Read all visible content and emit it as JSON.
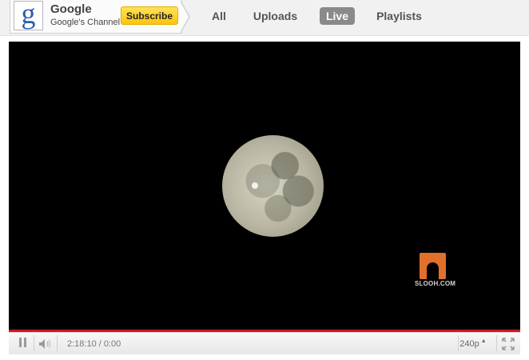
{
  "channel": {
    "name": "Google",
    "subtitle": "Google's Channel",
    "avatar_letter": "g",
    "subscribe_label": "Subscribe",
    "accent": "#ffc40d"
  },
  "tabs": [
    {
      "label": "All",
      "active": false
    },
    {
      "label": "Uploads",
      "active": false
    },
    {
      "label": "Live",
      "active": true
    },
    {
      "label": "Playlists",
      "active": false
    }
  ],
  "video": {
    "watermark": "SLOOH.COM",
    "progress_color": "#cc181e"
  },
  "controls": {
    "time": "2:18:10 / 0:00",
    "quality": "240p",
    "icons": [
      "pause-icon",
      "volume-icon",
      "fullscreen-icon"
    ]
  }
}
